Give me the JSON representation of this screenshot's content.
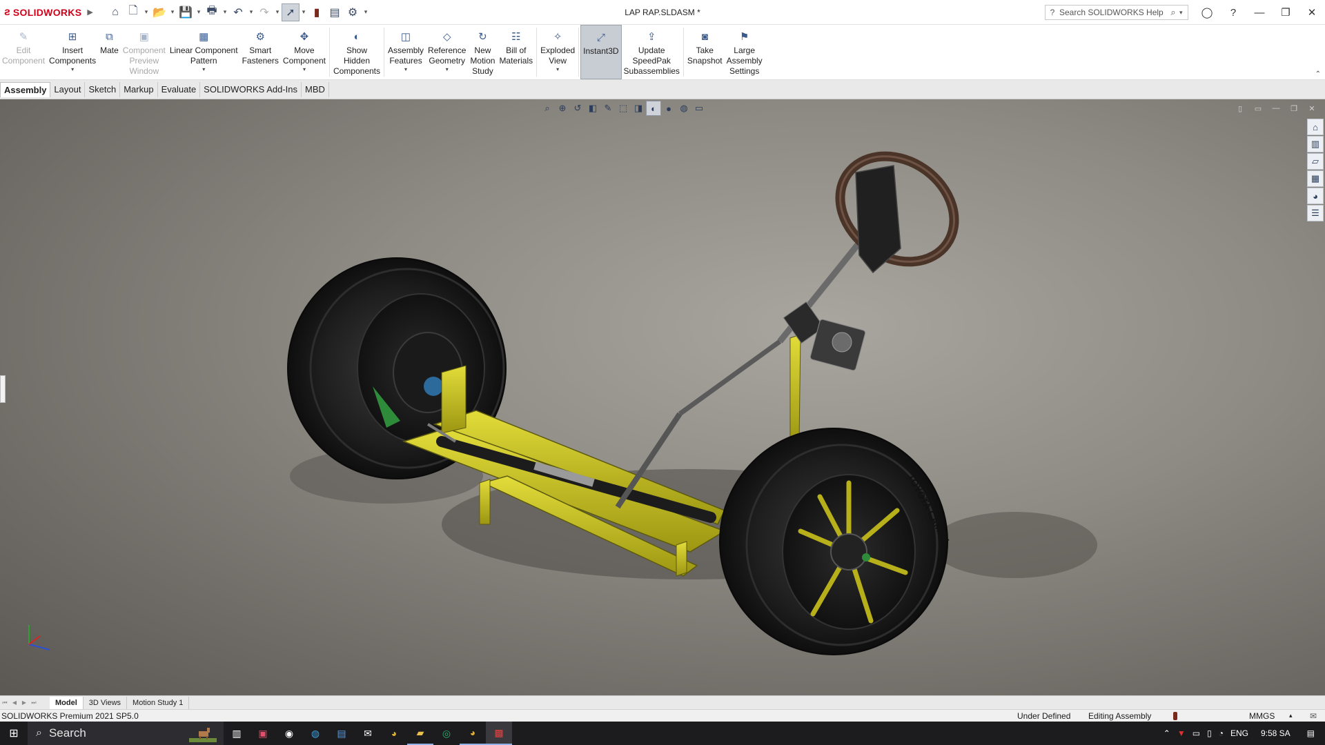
{
  "app": {
    "brand": "SOLIDWORKS",
    "document_title": "LAP RAP.SLDASM *",
    "help_search_placeholder": "Search SOLIDWORKS Help"
  },
  "ribbon": {
    "commands": [
      {
        "label": "Edit\nComponent",
        "icon": "edit-component-icon",
        "disabled": true
      },
      {
        "label": "Insert\nComponents",
        "icon": "insert-components-icon",
        "dropdown": true
      },
      {
        "label": "Mate",
        "icon": "mate-icon"
      },
      {
        "label": "Component\nPreview\nWindow",
        "icon": "preview-window-icon",
        "disabled": true
      },
      {
        "label": "Linear Component\nPattern",
        "icon": "linear-pattern-icon",
        "dropdown": true
      },
      {
        "label": "Smart\nFasteners",
        "icon": "smart-fasteners-icon"
      },
      {
        "label": "Move\nComponent",
        "icon": "move-component-icon",
        "dropdown": true
      },
      {
        "label": "Show\nHidden\nComponents",
        "icon": "show-hidden-icon"
      },
      {
        "label": "Assembly\nFeatures",
        "icon": "assembly-features-icon",
        "dropdown": true
      },
      {
        "label": "Reference\nGeometry",
        "icon": "reference-geometry-icon",
        "dropdown": true
      },
      {
        "label": "New\nMotion\nStudy",
        "icon": "motion-study-icon"
      },
      {
        "label": "Bill of\nMaterials",
        "icon": "bom-icon"
      },
      {
        "label": "Exploded\nView",
        "icon": "exploded-view-icon",
        "dropdown": true
      },
      {
        "label": "Instant3D",
        "icon": "instant3d-icon",
        "active": true
      },
      {
        "label": "Update\nSpeedPak\nSubassemblies",
        "icon": "speedpak-icon"
      },
      {
        "label": "Take\nSnapshot",
        "icon": "snapshot-icon"
      },
      {
        "label": "Large\nAssembly\nSettings",
        "icon": "large-assembly-icon"
      }
    ]
  },
  "command_tabs": [
    "Assembly",
    "Layout",
    "Sketch",
    "Markup",
    "Evaluate",
    "SOLIDWORKS Add-Ins",
    "MBD"
  ],
  "active_command_tab": "Assembly",
  "bottom_tabs": [
    "Model",
    "3D Views",
    "Motion Study 1"
  ],
  "active_bottom_tab": "Model",
  "status": {
    "product": "SOLIDWORKS Premium 2021 SP5.0",
    "state": "Under Defined",
    "mode": "Editing Assembly",
    "units": "MMGS"
  },
  "model": {
    "tire_text": "TOYOTA CAMRY",
    "frame_color": "#c9c417",
    "tire_color": "#1d1d1d",
    "wheel_accent": "#b8b01a",
    "steering_wheel_color": "#4a3428"
  },
  "taskbar": {
    "search_placeholder": "Search",
    "language": "ENG",
    "time": "9:58 SA"
  }
}
